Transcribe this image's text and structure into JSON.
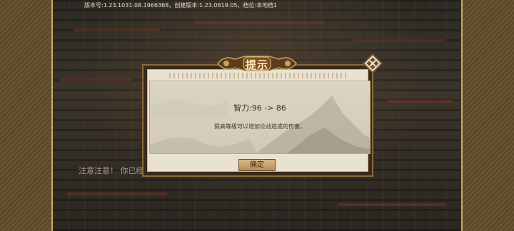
{
  "header": {
    "version_info": "版本号:1.23.1031.08.1966368，创建版本:1.23.0619.05，档位:本地档1"
  },
  "background": {
    "notice_text": "注意注意！ 你已经"
  },
  "dialog": {
    "title": "提示",
    "stat_change": "智力:96 -> 86",
    "description": "提高等级可以增加论战造成的伤害。",
    "confirm_label": "确定",
    "close_icon": "close-diamond-icon"
  },
  "colors": {
    "title_text": "#fbe8b8",
    "body_text": "#3f3526",
    "frame": "#8c6a3e",
    "panel": "#dcd5c3"
  }
}
